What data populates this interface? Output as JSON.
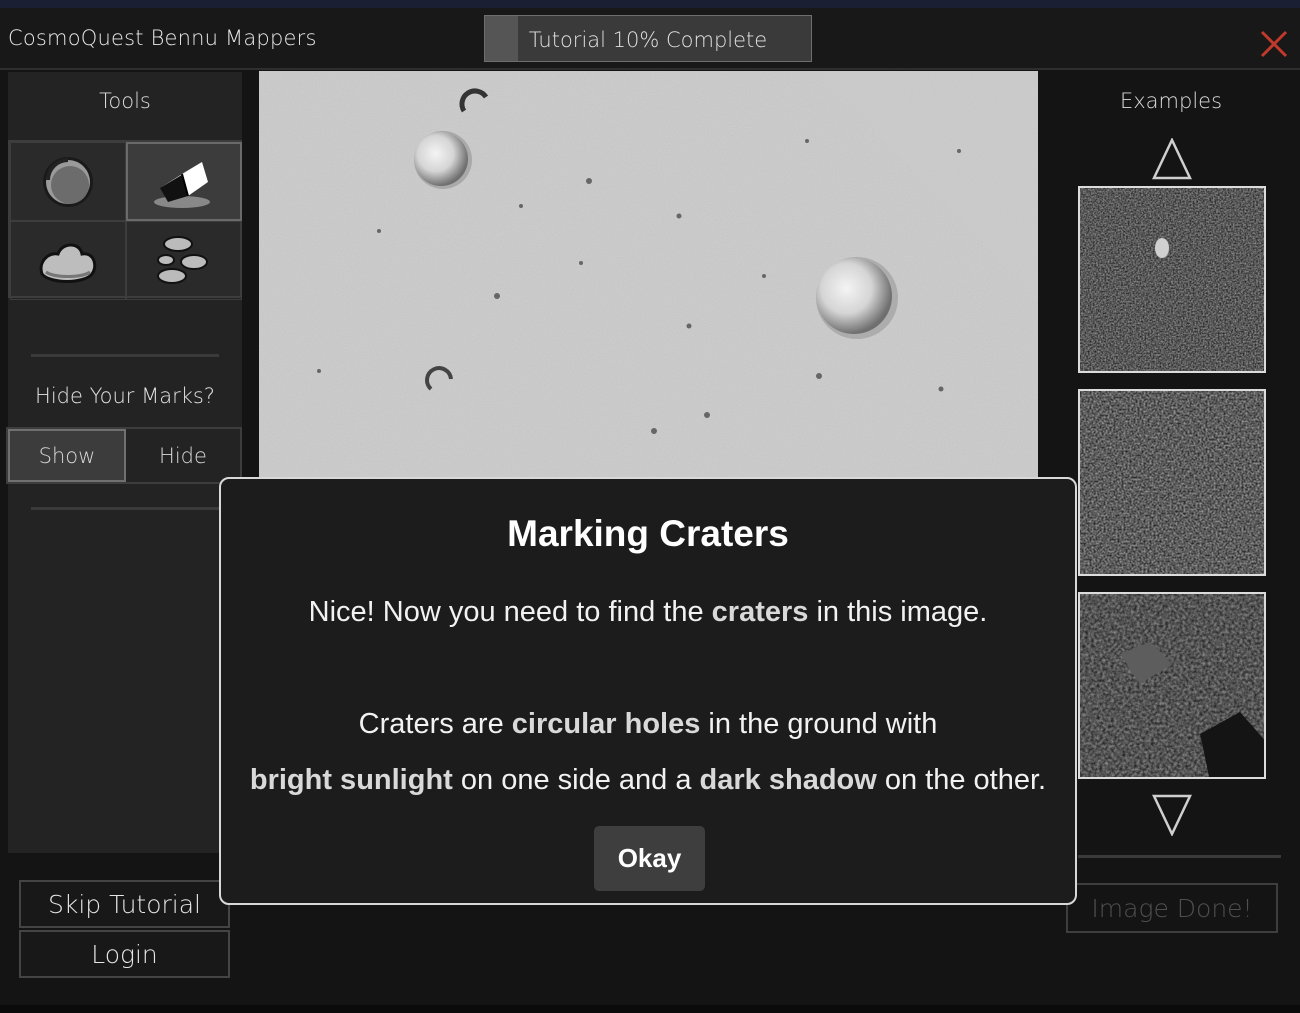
{
  "app": {
    "title": "CosmoQuest Bennu Mappers",
    "close_icon": "close-icon",
    "accent": "#c0392b"
  },
  "progress": {
    "label": "Tutorial 10% Complete",
    "percent": 10
  },
  "tools": {
    "title": "Tools",
    "items": [
      {
        "name": "crater-tool",
        "icon": "crater-icon"
      },
      {
        "name": "eraser-tool",
        "icon": "eraser-icon",
        "active": true
      },
      {
        "name": "boulder-tool",
        "icon": "boulder-icon"
      },
      {
        "name": "rock-cluster-tool",
        "icon": "rocks-icon"
      }
    ]
  },
  "marks": {
    "label": "Hide Your Marks?",
    "show": "Show",
    "hide": "Hide",
    "selected": "Show"
  },
  "sidebar_buttons": {
    "skip": "Skip Tutorial",
    "login": "Login"
  },
  "examples": {
    "title": "Examples",
    "up_icon": "triangle-up-icon",
    "down_icon": "triangle-down-icon"
  },
  "done_button": "Image Done!",
  "modal": {
    "title": "Marking Craters",
    "line1_a": "Nice! Now you need to find the ",
    "line1_b": "craters",
    "line1_c": " in this image.",
    "line2_a": "Craters are ",
    "line2_b": "circular holes",
    "line2_c": " in the ground with",
    "line3_a": "bright sunlight",
    "line3_b": " on one side and a ",
    "line3_c": "dark shadow",
    "line3_d": " on the other.",
    "button": "Okay"
  }
}
